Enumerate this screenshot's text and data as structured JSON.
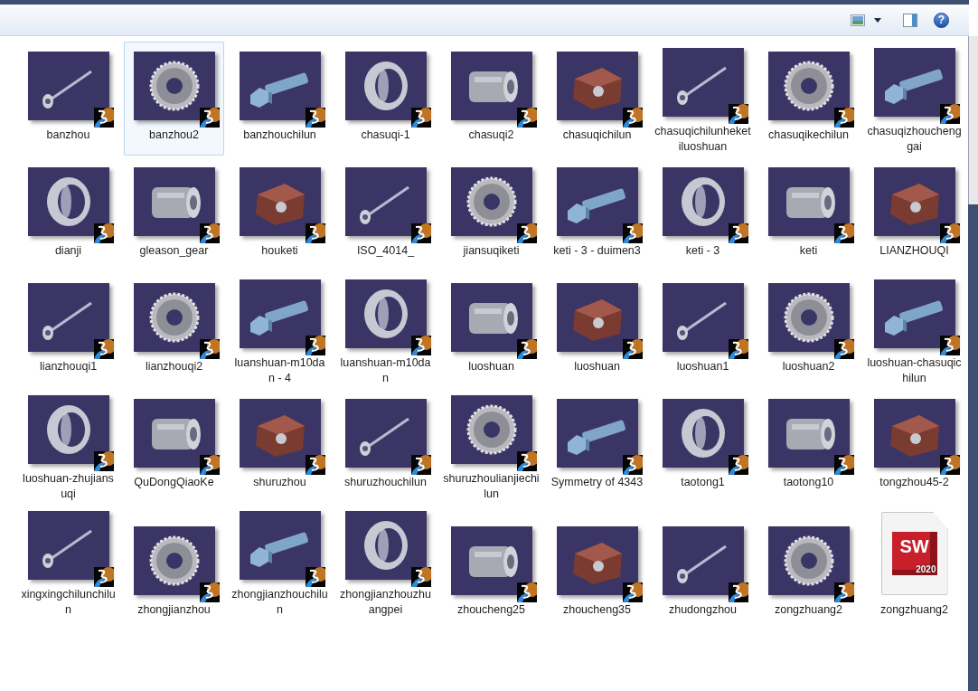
{
  "toolbar": {
    "help": "?"
  },
  "items": [
    {
      "name": "banzhou",
      "kind": "catia",
      "selected": false
    },
    {
      "name": "banzhou2",
      "kind": "catia",
      "selected": true
    },
    {
      "name": "banzhouchilun",
      "kind": "catia",
      "selected": false
    },
    {
      "name": "chasuqi-1",
      "kind": "catia",
      "selected": false
    },
    {
      "name": "chasuqi2",
      "kind": "catia",
      "selected": false
    },
    {
      "name": "chasuqichilun",
      "kind": "catia",
      "selected": false
    },
    {
      "name": "chasuqichilunheketiluoshuan",
      "kind": "catia",
      "selected": false
    },
    {
      "name": "chasuqikechilun",
      "kind": "catia",
      "selected": false
    },
    {
      "name": "chasuqizhouchenggai",
      "kind": "catia",
      "selected": false
    },
    {
      "name": "dianji",
      "kind": "catia",
      "selected": false
    },
    {
      "name": "gleason_gear",
      "kind": "catia",
      "selected": false
    },
    {
      "name": "houketi",
      "kind": "catia",
      "selected": false
    },
    {
      "name": "ISO_4014_",
      "kind": "catia",
      "selected": false
    },
    {
      "name": "jiansuqiketi",
      "kind": "catia",
      "selected": false
    },
    {
      "name": "keti - 3 - duimen3",
      "kind": "catia",
      "selected": false
    },
    {
      "name": "keti - 3",
      "kind": "catia",
      "selected": false
    },
    {
      "name": "keti",
      "kind": "catia",
      "selected": false
    },
    {
      "name": "LIANZHOUQI",
      "kind": "catia",
      "selected": false
    },
    {
      "name": "lianzhouqi1",
      "kind": "catia",
      "selected": false
    },
    {
      "name": "lianzhouqi2",
      "kind": "catia",
      "selected": false
    },
    {
      "name": "luanshuan-m10dan - 4",
      "kind": "catia",
      "selected": false
    },
    {
      "name": "luanshuan-m10dan",
      "kind": "catia",
      "selected": false
    },
    {
      "name": "luoshuan",
      "kind": "catia",
      "selected": false
    },
    {
      "name": "luoshuan",
      "kind": "catia",
      "selected": false
    },
    {
      "name": "luoshuan1",
      "kind": "catia",
      "selected": false
    },
    {
      "name": "luoshuan2",
      "kind": "catia",
      "selected": false
    },
    {
      "name": "luoshuan-chasuqichilun",
      "kind": "catia",
      "selected": false
    },
    {
      "name": "luoshuan-zhujiansuqi",
      "kind": "catia",
      "selected": false
    },
    {
      "name": "QuDongQiaoKe",
      "kind": "catia",
      "selected": false
    },
    {
      "name": "shuruzhou",
      "kind": "catia",
      "selected": false
    },
    {
      "name": "shuruzhouchilun",
      "kind": "catia",
      "selected": false
    },
    {
      "name": "shuruzhoulianjiechilun",
      "kind": "catia",
      "selected": false
    },
    {
      "name": "Symmetry of 4343",
      "kind": "catia",
      "selected": false
    },
    {
      "name": "taotong1",
      "kind": "catia",
      "selected": false
    },
    {
      "name": "taotong10",
      "kind": "catia",
      "selected": false
    },
    {
      "name": "tongzhou45-2",
      "kind": "catia",
      "selected": false
    },
    {
      "name": "xingxingchilunchilun",
      "kind": "catia",
      "selected": false
    },
    {
      "name": "zhongjianzhou",
      "kind": "catia",
      "selected": false
    },
    {
      "name": "zhongjianzhouchilun",
      "kind": "catia",
      "selected": false
    },
    {
      "name": "zhongjianzhouzhuangpei",
      "kind": "catia",
      "selected": false
    },
    {
      "name": "zhoucheng25",
      "kind": "catia",
      "selected": false
    },
    {
      "name": "zhoucheng35",
      "kind": "catia",
      "selected": false
    },
    {
      "name": "zhudongzhou",
      "kind": "catia",
      "selected": false
    },
    {
      "name": "zongzhuang2",
      "kind": "catia",
      "selected": false
    },
    {
      "name": "zongzhuang2",
      "kind": "solidworks",
      "selected": false,
      "logo": "SW",
      "version": "2020"
    }
  ]
}
